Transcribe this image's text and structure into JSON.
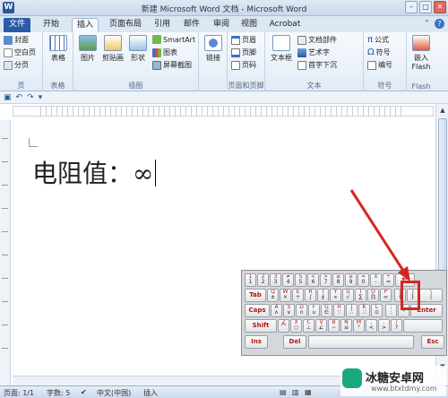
{
  "window": {
    "title": "新建 Microsoft Word 文档 - Microsoft Word",
    "app_icon": "W"
  },
  "tabs": [
    "文件",
    "开始",
    "插入",
    "页面布局",
    "引用",
    "邮件",
    "审阅",
    "视图",
    "Acrobat"
  ],
  "active_tab": "插入",
  "ribbon": {
    "pages": {
      "label": "页",
      "items": [
        "封面",
        "空白页",
        "分页"
      ]
    },
    "table": {
      "label": "表格",
      "button": "表格"
    },
    "illustrations": {
      "label": "插图",
      "buttons": [
        "图片",
        "剪贴画",
        "形状"
      ],
      "items": [
        "SmartArt",
        "图表",
        "屏幕截图"
      ]
    },
    "links": {
      "label": "",
      "button": "链接"
    },
    "header_footer": {
      "label": "页眉和页脚",
      "items": [
        "页眉",
        "页脚",
        "页码"
      ]
    },
    "text": {
      "label": "文本",
      "button": "文本框",
      "items": [
        "文档部件",
        "艺术字",
        "首字下沉"
      ]
    },
    "symbols": {
      "label": "符号",
      "items": [
        "公式",
        "符号",
        "编号"
      ]
    },
    "flash": {
      "label": "Flash",
      "button1": "嵌入",
      "button2": "Flash"
    }
  },
  "document": {
    "text": "电阻值：∞"
  },
  "status": {
    "page": "页面: 1/1",
    "words": "字数: 5",
    "language": "中文(中国)",
    "mode": "插入"
  },
  "keyboard": {
    "row1": [
      {
        "t": "1",
        "b": "1"
      },
      {
        "t": "2",
        "b": "2"
      },
      {
        "t": "3",
        "b": "3"
      },
      {
        "t": "≠",
        "b": "4"
      },
      {
        "t": "5",
        "b": "5"
      },
      {
        "t": "<",
        "b": "6"
      },
      {
        "t": ">",
        "b": "7"
      },
      {
        "t": "≤",
        "b": "8"
      },
      {
        "t": "≥",
        "b": "9"
      },
      {
        "t": "=",
        "b": "0"
      },
      {
        "t": "±",
        "b": "-"
      },
      {
        "t": "÷",
        "b": "="
      }
    ],
    "row2": [
      {
        "t": "Q",
        "b": "±"
      },
      {
        "t": "W",
        "b": "×"
      },
      {
        "t": "E",
        "b": "÷"
      },
      {
        "t": "R",
        "b": "∫"
      },
      {
        "t": "T",
        "b": "∮"
      },
      {
        "t": "Y",
        "b": "∝"
      },
      {
        "t": "U",
        "b": "√"
      },
      {
        "t": "I",
        "b": "∑"
      },
      {
        "t": "O",
        "b": "∏"
      },
      {
        "t": "P",
        "b": "∞"
      }
    ],
    "row3": [
      {
        "t": "A",
        "b": "∧"
      },
      {
        "t": "S",
        "b": "∨"
      },
      {
        "t": "D",
        "b": "∩"
      },
      {
        "t": "F",
        "b": "∪"
      },
      {
        "t": "G",
        "b": "∈"
      },
      {
        "t": "H",
        "b": "∵"
      },
      {
        "t": "J",
        "b": "∴"
      },
      {
        "t": "K",
        "b": "∷"
      },
      {
        "t": "L",
        "b": "⊙"
      }
    ],
    "row4": [
      {
        "t": "Z",
        "b": "⌒"
      },
      {
        "t": "X",
        "b": "○"
      },
      {
        "t": "C",
        "b": "⊥"
      },
      {
        "t": "V",
        "b": "∠"
      },
      {
        "t": "B",
        "b": "∽"
      },
      {
        "t": "N",
        "b": "≌"
      },
      {
        "t": "M",
        "b": "°"
      }
    ],
    "tab": "Tab",
    "caps": "Caps",
    "shift": "Shift",
    "enter": "Enter",
    "ins": "Ins",
    "del": "Del",
    "esc": "Esc",
    "backspace": "←"
  },
  "watermark": {
    "cn": "冰糖安卓网",
    "url": "www.btxtdmy.com"
  }
}
